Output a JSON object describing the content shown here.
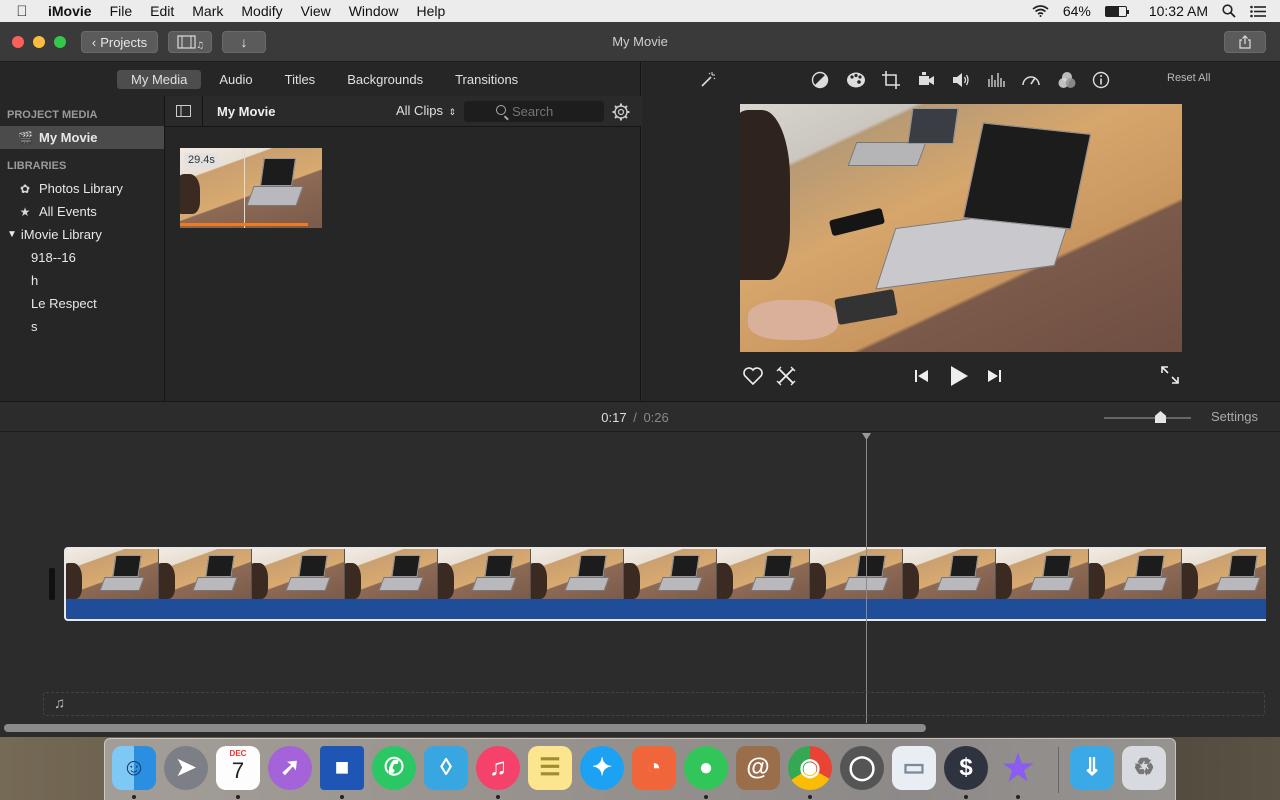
{
  "menubar": {
    "app_name": "iMovie",
    "items": [
      "File",
      "Edit",
      "Mark",
      "Modify",
      "View",
      "Window",
      "Help"
    ],
    "battery": "64%",
    "battery_level": 0.64,
    "clock": "10:32 AM"
  },
  "titlebar": {
    "projects_label": "Projects",
    "title": "My Movie"
  },
  "browser": {
    "tabs": [
      "My Media",
      "Audio",
      "Titles",
      "Backgrounds",
      "Transitions"
    ],
    "active_tab": "My Media",
    "sidebar": {
      "project_media_header": "PROJECT MEDIA",
      "project_item": "My Movie",
      "libraries_header": "LIBRARIES",
      "photos_library": "Photos Library",
      "all_events": "All Events",
      "imovie_library": "iMovie Library",
      "events": [
        "918--16",
        "h",
        "Le Respect",
        "s"
      ]
    },
    "toolbar": {
      "title": "My Movie",
      "filter": "All Clips",
      "search_placeholder": "Search"
    },
    "clip": {
      "duration": "29.4s"
    }
  },
  "viewer": {
    "reset_all": "Reset All",
    "tools": [
      "magic-wand-icon",
      "color-balance-icon",
      "color-correction-icon",
      "crop-icon",
      "stabilization-icon",
      "volume-icon",
      "noise-reduction-icon",
      "speed-icon",
      "clip-filter-icon",
      "info-icon"
    ]
  },
  "timeline": {
    "current_time": "0:17",
    "separator": "/",
    "total_time": "0:26",
    "settings_label": "Settings"
  },
  "dock": {
    "apps": [
      "Finder",
      "Launchpad",
      "Calendar",
      "Safari",
      "Dictionary",
      "Phone",
      "Preview",
      "Music",
      "Notes",
      "Twitter",
      "Keynote",
      "Messages",
      "Contacts",
      "Chrome",
      "Camera",
      "Files",
      "Money",
      "iMovie",
      "Downloads",
      "Trash"
    ],
    "calendar_month": "DEC",
    "calendar_day": "7"
  }
}
